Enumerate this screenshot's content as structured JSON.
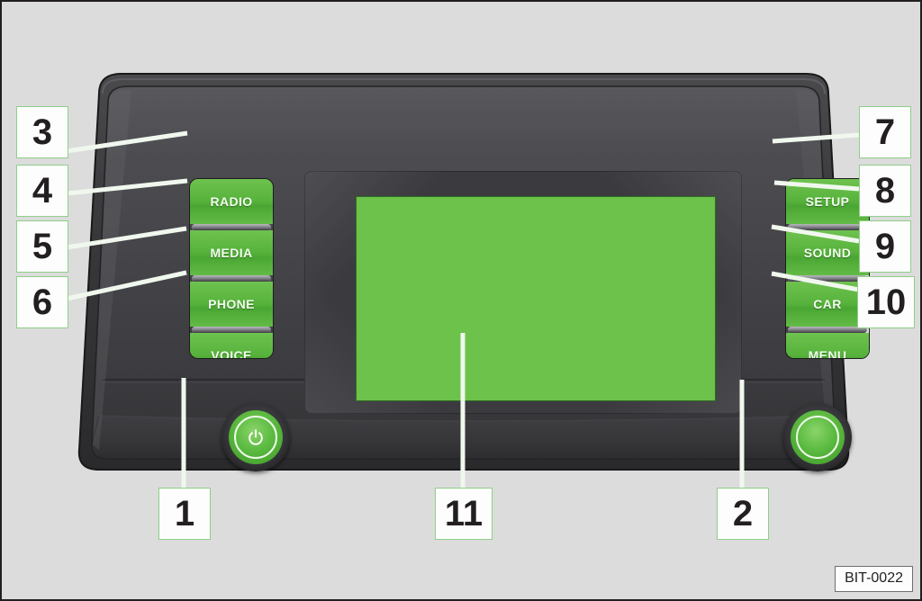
{
  "figure": {
    "code": "BIT-0022",
    "background_color": "#dcdcdc",
    "accent_green": "#57b33c",
    "screen_color": "#6cc24a"
  },
  "device": {
    "name": "car-infotainment-head-unit",
    "screen": {
      "label": "",
      "color": "#6cc24a"
    }
  },
  "left_buttons": [
    {
      "label": "RADIO",
      "callout": "3"
    },
    {
      "label": "MEDIA",
      "callout": "4"
    },
    {
      "label": "PHONE",
      "callout": "5"
    },
    {
      "label": "VOICE",
      "callout": "6"
    }
  ],
  "right_buttons": [
    {
      "label": "SETUP",
      "callout": "7"
    },
    {
      "label": "SOUND",
      "callout": "8"
    },
    {
      "label": "CAR",
      "callout": "9"
    },
    {
      "label": "MENU",
      "callout": "10"
    }
  ],
  "knobs": [
    {
      "name": "power-volume-knob",
      "callout": "1",
      "icon": "power-icon"
    },
    {
      "name": "tune-select-knob",
      "callout": "2",
      "icon": ""
    }
  ],
  "callouts": {
    "n1": "1",
    "n2": "2",
    "n3": "3",
    "n4": "4",
    "n5": "5",
    "n6": "6",
    "n7": "7",
    "n8": "8",
    "n9": "9",
    "n10": "10",
    "n11": "11"
  }
}
